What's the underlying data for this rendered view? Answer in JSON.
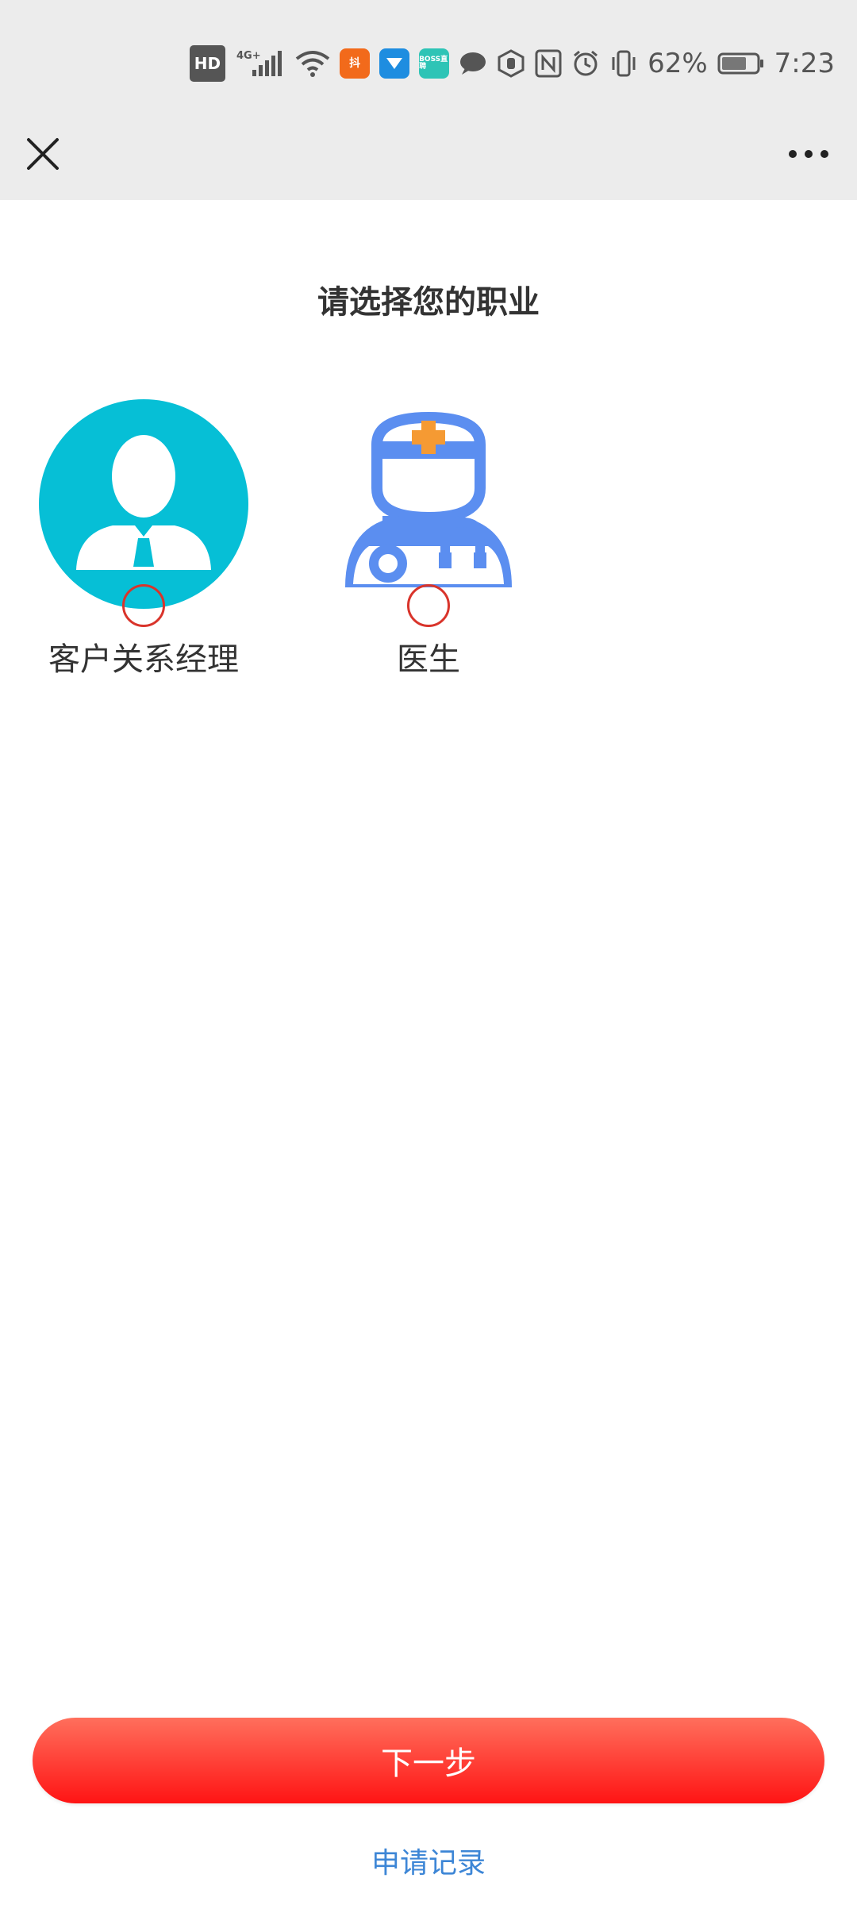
{
  "status_bar": {
    "hd": "HD",
    "network": "4G+",
    "app_badge_1": "抖",
    "app_badge_3": "BOSS直聘",
    "battery_percent": "62%",
    "time": "7:23"
  },
  "nav": {
    "close_icon": "close-icon",
    "more_icon": "more-icon"
  },
  "page": {
    "title": "请选择您的职业"
  },
  "occupations": [
    {
      "label": "客户关系经理",
      "icon": "business-person-icon",
      "color": "#06bfd6",
      "selected": false
    },
    {
      "label": "医生",
      "icon": "doctor-icon",
      "color": "#5b8ef0",
      "cross_color": "#f59a33",
      "selected": false
    }
  ],
  "actions": {
    "next_label": "下一步",
    "apply_record_label": "申请记录"
  }
}
